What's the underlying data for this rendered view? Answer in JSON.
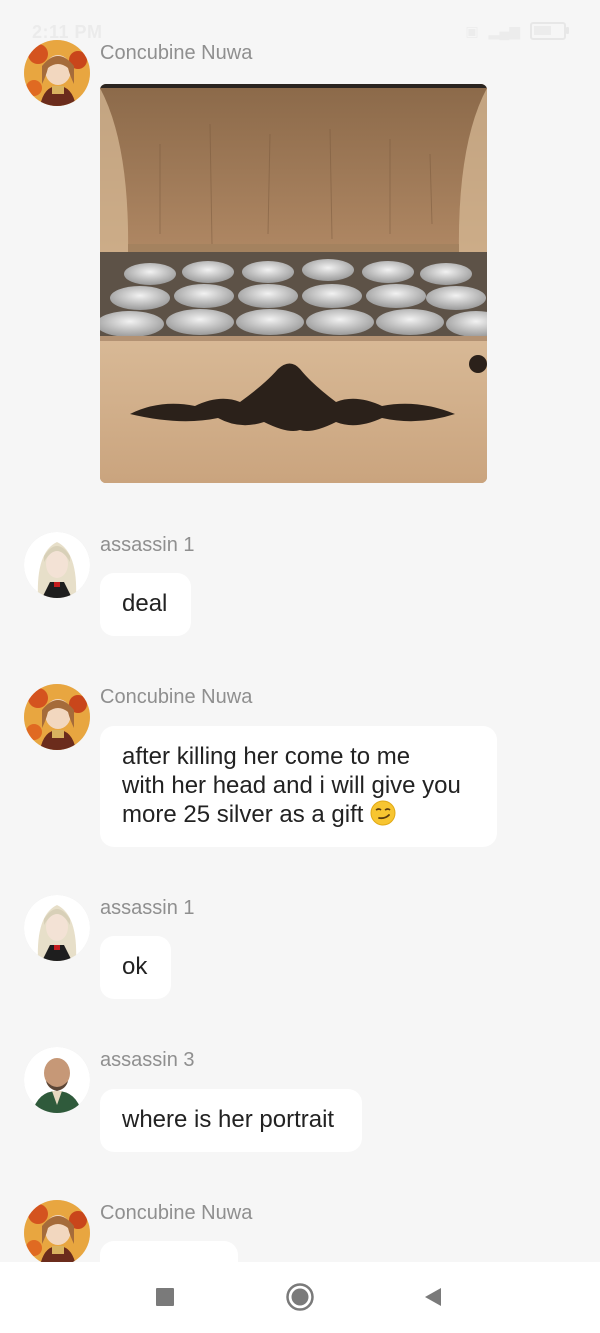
{
  "status_bar": {
    "time": "2:11 PM",
    "battery": "61"
  },
  "messages": [
    {
      "sender": "Concubine Nuwa",
      "type": "image",
      "image_description": "wooden chest with silver ingots"
    },
    {
      "sender": "assassin 1",
      "text": "deal"
    },
    {
      "sender": "Concubine Nuwa",
      "lines": [
        "after killing her come to me",
        "with her head and i will give you",
        "more 25 silver as a gift"
      ],
      "emoji": "smirk-emoji"
    },
    {
      "sender": "assassin 1",
      "text": "ok"
    },
    {
      "sender": "assassin 3",
      "text": "where is her portrait"
    },
    {
      "sender": "Concubine Nuwa",
      "text": ""
    }
  ],
  "nav": {
    "buttons": [
      "recent-apps",
      "home",
      "back"
    ]
  },
  "colors": {
    "background": "#f6f6f6",
    "bubble": "#ffffff",
    "sender": "#8f8f8f",
    "text": "#222222"
  }
}
